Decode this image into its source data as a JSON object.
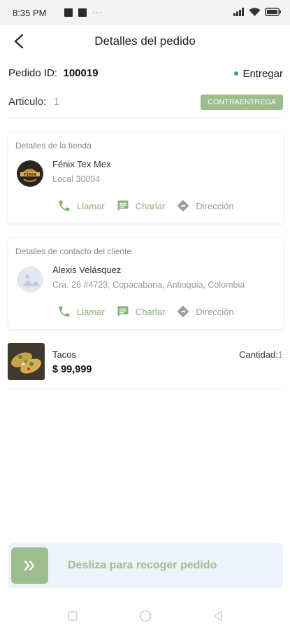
{
  "status_bar": {
    "time": "8:35 PM",
    "icons": [
      "notification-square-icon",
      "notification-square-icon",
      "more-dots-icon",
      "signal-icon",
      "wifi-icon",
      "battery-icon"
    ],
    "more_text": "···"
  },
  "header": {
    "title": "Detalles del pedido",
    "back_icon": "back-arrow-icon"
  },
  "order": {
    "id_label": "Pedido ID:",
    "id_value": "100019",
    "status": "Entregar",
    "status_color": "#3aa55d",
    "article_label": "Articulo:",
    "article_value": "1",
    "payment_badge": "CONTRAENTREGA"
  },
  "store_card": {
    "title": "Detalles de la tienda",
    "name": "Fénix Tex Mex",
    "address": "Local 30004",
    "logo_text": "FÉNIX",
    "actions": [
      {
        "label": "Llamar",
        "icon": "phone-icon"
      },
      {
        "label": "Charlar",
        "icon": "chat-icon"
      },
      {
        "label": "Dirección",
        "icon": "directions-icon"
      }
    ]
  },
  "client_card": {
    "title": "Detalles de contacto del cliente",
    "name": "Alexis Velásquez",
    "address": "Cra. 26 #4723, Copacabana, Antioquia, Colombia",
    "actions": [
      {
        "label": "Llamar",
        "icon": "phone-icon"
      },
      {
        "label": "Charlar",
        "icon": "chat-icon"
      },
      {
        "label": "Dirección",
        "icon": "directions-icon"
      }
    ]
  },
  "product": {
    "name": "Tacos",
    "price": "$ 99,999",
    "quantity_label": "Cantidad:",
    "quantity_value": "1"
  },
  "slider": {
    "label": "Desliza para recoger pedido",
    "icon": "double-chevron-right-icon"
  },
  "nav_bar": {
    "buttons": [
      "recent-apps-icon",
      "home-icon",
      "back-icon"
    ]
  },
  "colors": {
    "accent_green": "#9dbd8e",
    "accent_text_green": "#8bb07b",
    "slider_bg": "#eef3fb"
  }
}
